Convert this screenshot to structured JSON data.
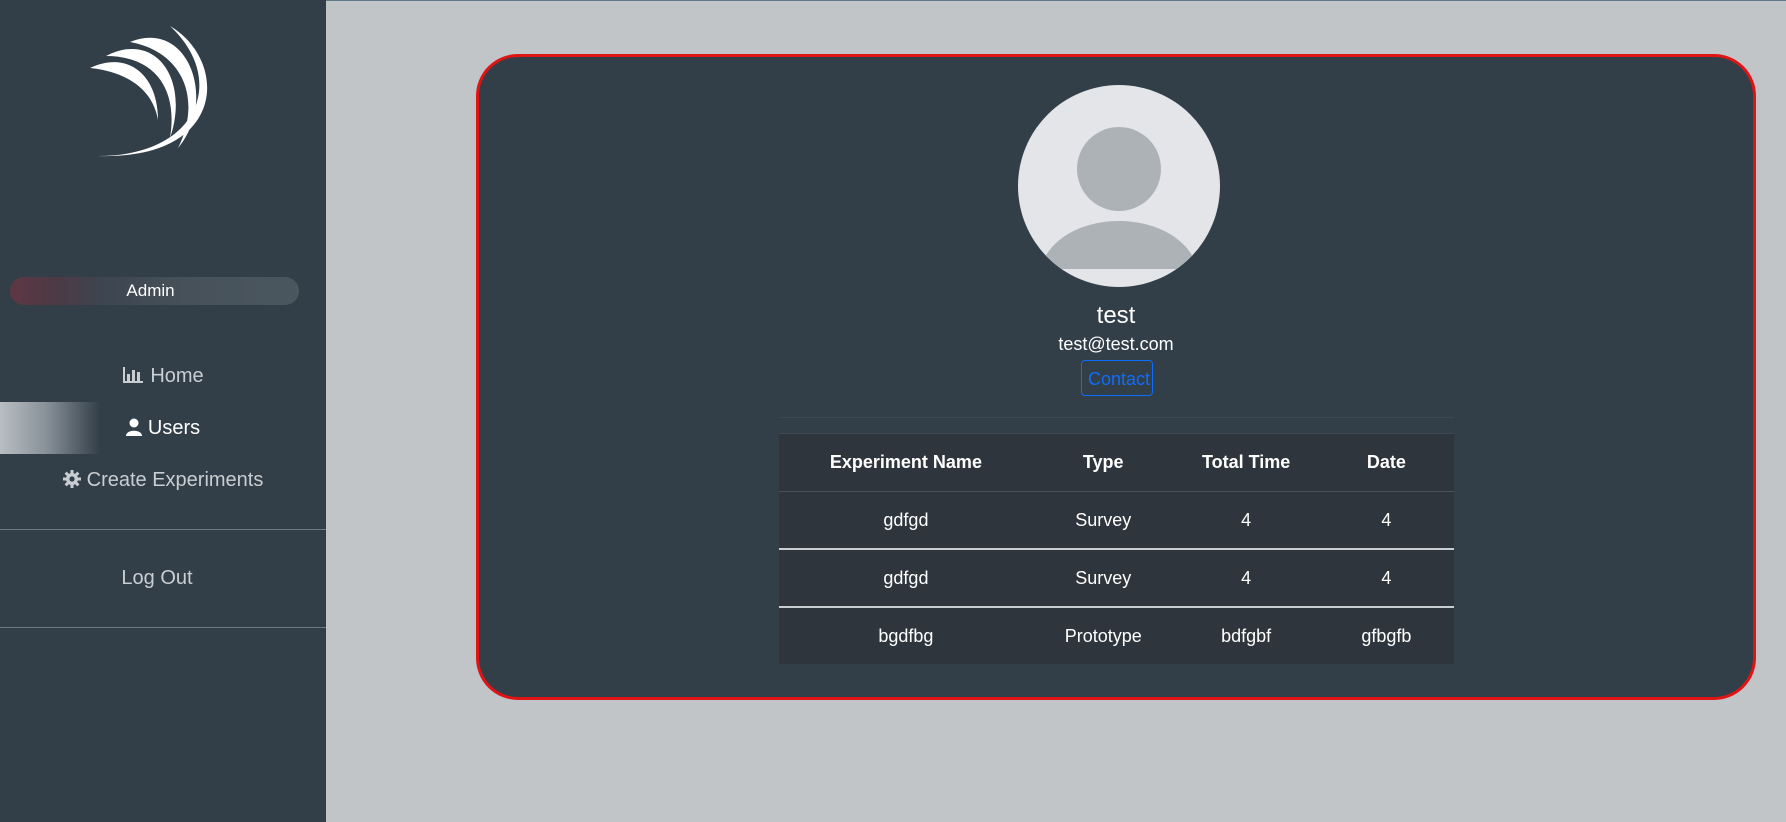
{
  "sidebar": {
    "role": "Admin",
    "nav": [
      {
        "label": "Home",
        "icon": "bar-chart-icon"
      },
      {
        "label": "Users",
        "icon": "user-icon",
        "active": true
      },
      {
        "label": "Create Experiments",
        "icon": "gear-icon"
      }
    ],
    "logout": "Log Out"
  },
  "profile": {
    "name": "test",
    "email": "test@test.com",
    "contact_label": "Contact"
  },
  "experiments": {
    "columns": [
      "Experiment Name",
      "Type",
      "Total Time",
      "Date"
    ],
    "rows": [
      [
        "gdfgd",
        "Survey",
        "4",
        "4"
      ],
      [
        "gdfgd",
        "Survey",
        "4",
        "4"
      ],
      [
        "bgdfbg",
        "Prototype",
        "bdfgbf",
        "gfbgfb"
      ]
    ]
  },
  "colors": {
    "sidebar_bg": "#323e48",
    "page_bg": "#c1c5c8",
    "card_border": "#e01414",
    "accent": "#0d6efd"
  }
}
